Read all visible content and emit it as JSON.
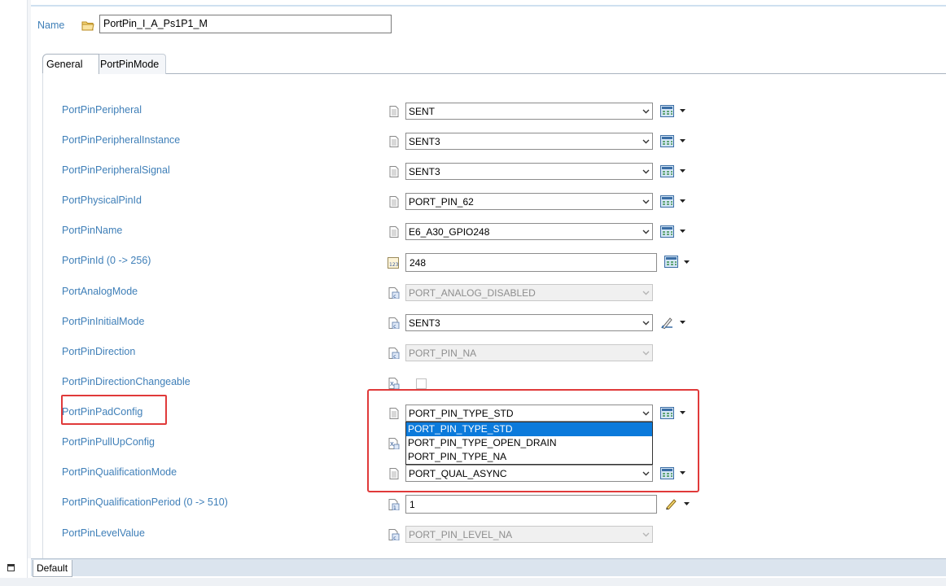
{
  "name_row": {
    "label": "Name",
    "value": "PortPin_I_A_Ps1P1_M"
  },
  "tabs": [
    {
      "label": "General"
    },
    {
      "label": "PortPinMode"
    }
  ],
  "params": [
    {
      "label": "PortPinPeripheral",
      "value": "SENT",
      "control": "combo"
    },
    {
      "label": "PortPinPeripheralInstance",
      "value": "SENT3",
      "control": "combo"
    },
    {
      "label": "PortPinPeripheralSignal",
      "value": "SENT3",
      "control": "combo"
    },
    {
      "label": "PortPhysicalPinId",
      "value": "PORT_PIN_62",
      "control": "combo"
    },
    {
      "label": "PortPinName",
      "value": "E6_A30_GPIO248",
      "control": "combo"
    },
    {
      "label": "PortPinId (0 -> 256)",
      "value": "248",
      "control": "text"
    },
    {
      "label": "PortAnalogMode",
      "value": "PORT_ANALOG_DISABLED",
      "control": "combo-disabled"
    },
    {
      "label": "PortPinInitialMode",
      "value": "SENT3",
      "control": "combo"
    },
    {
      "label": "PortPinDirection",
      "value": "PORT_PIN_NA",
      "control": "combo-disabled"
    },
    {
      "label": "PortPinDirectionChangeable",
      "value": "",
      "control": "checkbox"
    },
    {
      "label": "PortPinPadConfig",
      "value": "PORT_PIN_TYPE_STD",
      "control": "combo"
    },
    {
      "label": "PortPinPullUpConfig",
      "value": "",
      "control": "hidden"
    },
    {
      "label": "PortPinQualificationMode",
      "value": "PORT_QUAL_ASYNC",
      "control": "combo"
    },
    {
      "label": "PortPinQualificationPeriod (0 -> 510)",
      "value": "1",
      "control": "text"
    },
    {
      "label": "PortPinLevelValue",
      "value": "PORT_PIN_LEVEL_NA",
      "control": "combo-disabled"
    }
  ],
  "dropdown": {
    "options": [
      "PORT_PIN_TYPE_STD",
      "PORT_PIN_TYPE_OPEN_DRAIN",
      "PORT_PIN_TYPE_NA"
    ],
    "selected_index": 0
  },
  "bottom_tab": {
    "label": "Default"
  },
  "colors": {
    "label": "#3f7fb8",
    "highlight": "#e03a3a",
    "selection": "#0b7adb"
  }
}
